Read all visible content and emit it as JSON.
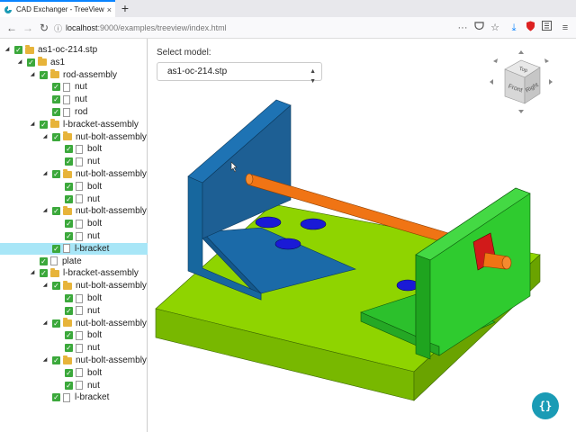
{
  "browser": {
    "tab_title": "CAD Exchanger - TreeView",
    "tab_close": "×",
    "new_tab": "+",
    "url_host": "localhost",
    "url_path": ":9000/examples/treeview/index.html",
    "more_icon": "···"
  },
  "tree": {
    "nodes": [
      {
        "label": "as1-oc-214.stp",
        "type": "folder",
        "level": 0,
        "expander": "◢"
      },
      {
        "label": "as1",
        "type": "folder",
        "level": 1,
        "expander": "◢"
      },
      {
        "label": "rod-assembly",
        "type": "folder",
        "level": 2,
        "expander": "◢"
      },
      {
        "label": "nut",
        "type": "file",
        "level": 3,
        "expander": ""
      },
      {
        "label": "nut",
        "type": "file",
        "level": 3,
        "expander": ""
      },
      {
        "label": "rod",
        "type": "file",
        "level": 3,
        "expander": ""
      },
      {
        "label": "l-bracket-assembly",
        "type": "folder",
        "level": 2,
        "expander": "◢"
      },
      {
        "label": "nut-bolt-assembly",
        "type": "folder",
        "level": 3,
        "expander": "◢"
      },
      {
        "label": "bolt",
        "type": "file",
        "level": 4,
        "expander": ""
      },
      {
        "label": "nut",
        "type": "file",
        "level": 4,
        "expander": ""
      },
      {
        "label": "nut-bolt-assembly",
        "type": "folder",
        "level": 3,
        "expander": "◢"
      },
      {
        "label": "bolt",
        "type": "file",
        "level": 4,
        "expander": ""
      },
      {
        "label": "nut",
        "type": "file",
        "level": 4,
        "expander": ""
      },
      {
        "label": "nut-bolt-assembly",
        "type": "folder",
        "level": 3,
        "expander": "◢"
      },
      {
        "label": "bolt",
        "type": "file",
        "level": 4,
        "expander": ""
      },
      {
        "label": "nut",
        "type": "file",
        "level": 4,
        "expander": ""
      },
      {
        "label": "l-bracket",
        "type": "file",
        "level": 3,
        "expander": "",
        "selected": true
      },
      {
        "label": "plate",
        "type": "file",
        "level": 2,
        "expander": ""
      },
      {
        "label": "l-bracket-assembly",
        "type": "folder",
        "level": 2,
        "expander": "◢"
      },
      {
        "label": "nut-bolt-assembly",
        "type": "folder",
        "level": 3,
        "expander": "◢"
      },
      {
        "label": "bolt",
        "type": "file",
        "level": 4,
        "expander": ""
      },
      {
        "label": "nut",
        "type": "file",
        "level": 4,
        "expander": ""
      },
      {
        "label": "nut-bolt-assembly",
        "type": "folder",
        "level": 3,
        "expander": "◢"
      },
      {
        "label": "bolt",
        "type": "file",
        "level": 4,
        "expander": ""
      },
      {
        "label": "nut",
        "type": "file",
        "level": 4,
        "expander": ""
      },
      {
        "label": "nut-bolt-assembly",
        "type": "folder",
        "level": 3,
        "expander": "◢"
      },
      {
        "label": "bolt",
        "type": "file",
        "level": 4,
        "expander": ""
      },
      {
        "label": "nut",
        "type": "file",
        "level": 4,
        "expander": ""
      },
      {
        "label": "l-bracket",
        "type": "file",
        "level": 3,
        "expander": ""
      }
    ]
  },
  "main": {
    "select_label": "Select model:",
    "selected_model": "as1-oc-214.stp",
    "viewcube": {
      "top": "Top",
      "front": "Front",
      "right": "Right"
    },
    "fab_label": "{}"
  },
  "colors": {
    "plate": "#8fd400",
    "bracket_blue": "#17679e",
    "bracket_green": "#2cc02c",
    "rod": "#f07414",
    "nut": "#1a1ad6"
  }
}
